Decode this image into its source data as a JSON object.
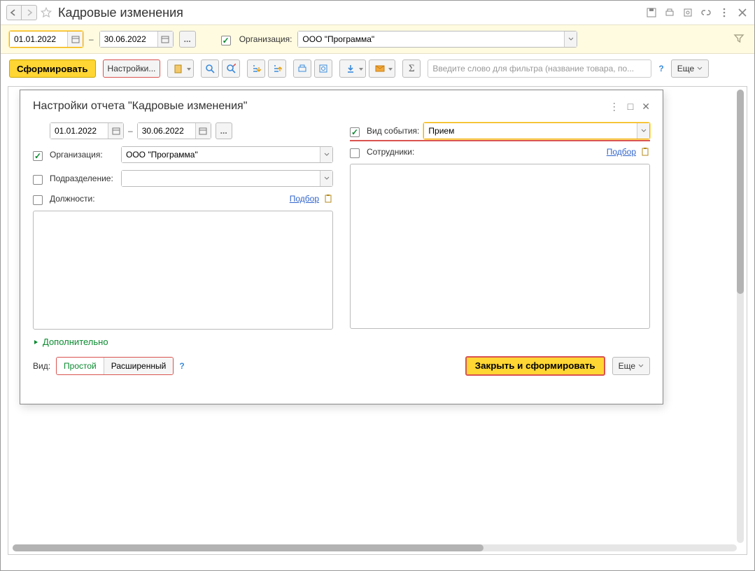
{
  "title": "Кадровые изменения",
  "filter": {
    "date_from": "01.01.2022",
    "date_to": "30.06.2022",
    "org_label": "Организация:",
    "org_value": "ООО \"Программа\""
  },
  "toolbar": {
    "form": "Сформировать",
    "settings": "Настройки...",
    "search_ph": "Введите слово для фильтра (название товара, по...",
    "more": "Еще"
  },
  "dialog": {
    "title": "Настройки отчета \"Кадровые изменения\"",
    "date_from": "01.01.2022",
    "date_to": "30.06.2022",
    "org_label": "Организация:",
    "org_value": "ООО \"Программа\"",
    "dept_label": "Подразделение:",
    "pos_label": "Должности:",
    "pick": "Подбор",
    "event_label": "Вид события:",
    "event_value": "Прием",
    "emp_label": "Сотрудники:",
    "adv": "Дополнительно",
    "view_label": "Вид:",
    "view_simple": "Простой",
    "view_ext": "Расширенный",
    "close_form": "Закрыть и сформировать",
    "more": "Еще"
  }
}
